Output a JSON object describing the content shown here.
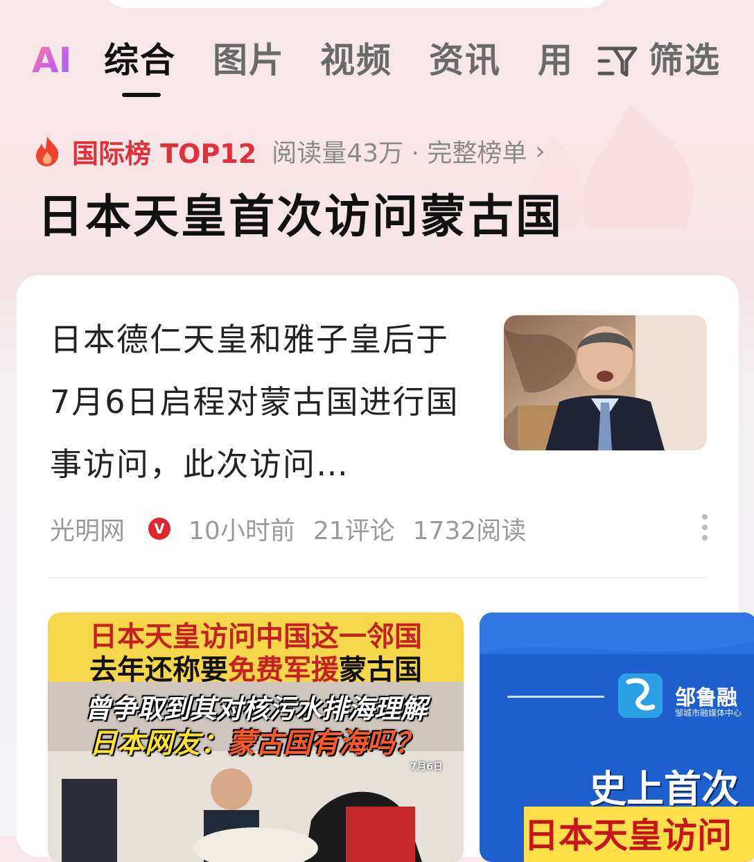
{
  "tabs": {
    "ai": "AI",
    "items": [
      "综合",
      "图片",
      "视频",
      "资讯",
      "用"
    ],
    "active_index": 0,
    "filter_label": "筛选"
  },
  "ranking": {
    "label": "国际榜 TOP12",
    "meta": "阅读量43万 · 完整榜单"
  },
  "topic_title": "日本天皇首次访问蒙古国",
  "article": {
    "text": "日本德仁天皇和雅子皇后于7月6日启程对蒙古国进行国事访问，此次访问…",
    "source": "光明网",
    "verified_badge": "V",
    "time": "10小时前",
    "comments": "21评论",
    "reads": "1732阅读"
  },
  "image_left": {
    "line1": "日本天皇访问中国这一邻国",
    "line2_a": "去年还称要",
    "line2_b": "免费军援",
    "line2_c": "蒙古国",
    "line3": "曾争取到其对核污水排海理解",
    "line4_a": "日本网友：",
    "line4_b": "蒙古国有海吗？",
    "date": "7月6日"
  },
  "image_right": {
    "brand": "邹鲁融",
    "brand_sub": "邹城市融媒体中心",
    "headline1": "史上首次",
    "headline2": "日本天皇访问"
  },
  "colors": {
    "accent_red": "#e1303a",
    "active_tab": "#111111",
    "inactive_tab": "#6a6a6a",
    "meta_gray": "#9a9a9a"
  }
}
